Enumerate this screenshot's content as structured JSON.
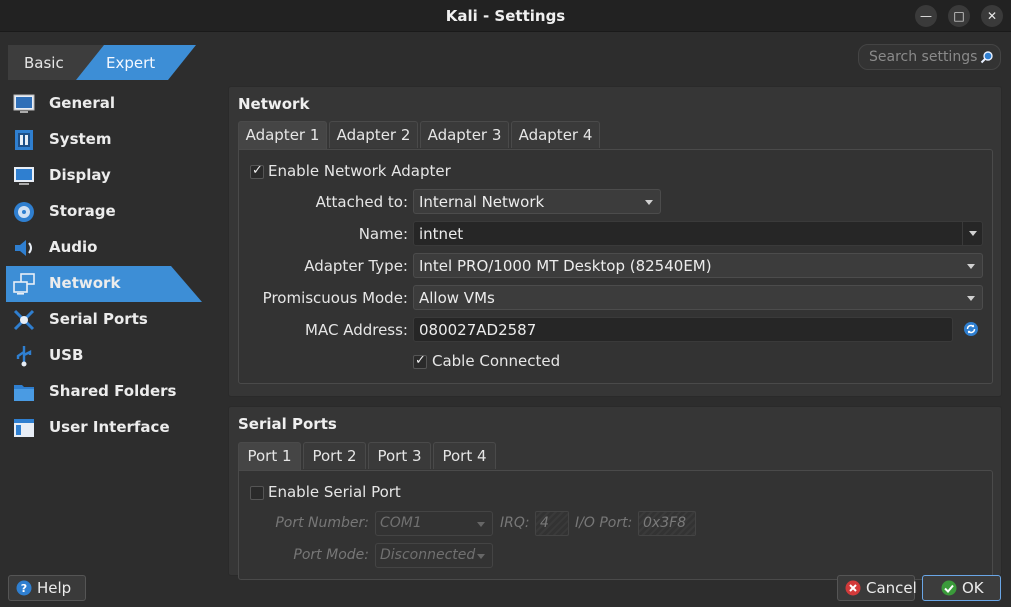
{
  "window": {
    "title": "Kali - Settings"
  },
  "modes": {
    "basic": "Basic",
    "expert": "Expert"
  },
  "search": {
    "placeholder": "Search settings"
  },
  "sidebar": {
    "items": [
      {
        "label": "General",
        "icon": "general-icon"
      },
      {
        "label": "System",
        "icon": "system-icon"
      },
      {
        "label": "Display",
        "icon": "display-icon"
      },
      {
        "label": "Storage",
        "icon": "storage-icon"
      },
      {
        "label": "Audio",
        "icon": "audio-icon"
      },
      {
        "label": "Network",
        "icon": "network-icon",
        "active": true
      },
      {
        "label": "Serial Ports",
        "icon": "serial-ports-icon"
      },
      {
        "label": "USB",
        "icon": "usb-icon"
      },
      {
        "label": "Shared Folders",
        "icon": "shared-folders-icon"
      },
      {
        "label": "User Interface",
        "icon": "user-interface-icon"
      }
    ]
  },
  "network": {
    "title": "Network",
    "tabs": [
      "Adapter 1",
      "Adapter 2",
      "Adapter 3",
      "Adapter 4"
    ],
    "enable_label": "Enable Network Adapter",
    "enabled": true,
    "attached_label": "Attached to:",
    "attached_value": "Internal Network",
    "name_label": "Name:",
    "name_value": "intnet",
    "adapter_type_label": "Adapter Type:",
    "adapter_type_value": "Intel PRO/1000 MT Desktop (82540EM)",
    "promisc_label": "Promiscuous Mode:",
    "promisc_value": "Allow VMs",
    "mac_label": "MAC Address:",
    "mac_value": "080027AD2587",
    "cable_label": "Cable Connected",
    "cable_connected": true
  },
  "serial": {
    "title": "Serial Ports",
    "tabs": [
      "Port 1",
      "Port 2",
      "Port 3",
      "Port 4"
    ],
    "enable_label": "Enable Serial Port",
    "enabled": false,
    "port_number_label": "Port Number:",
    "port_number_value": "COM1",
    "irq_label": "IRQ:",
    "irq_value": "4",
    "io_port_label": "I/O Port:",
    "io_port_value": "0x3F8",
    "port_mode_label": "Port Mode:",
    "port_mode_value": "Disconnected"
  },
  "buttons": {
    "help": "Help",
    "cancel": "Cancel",
    "ok": "OK"
  },
  "colors": {
    "accent": "#3d8ed6",
    "background": "#2d2d2d",
    "panel": "#363636"
  }
}
